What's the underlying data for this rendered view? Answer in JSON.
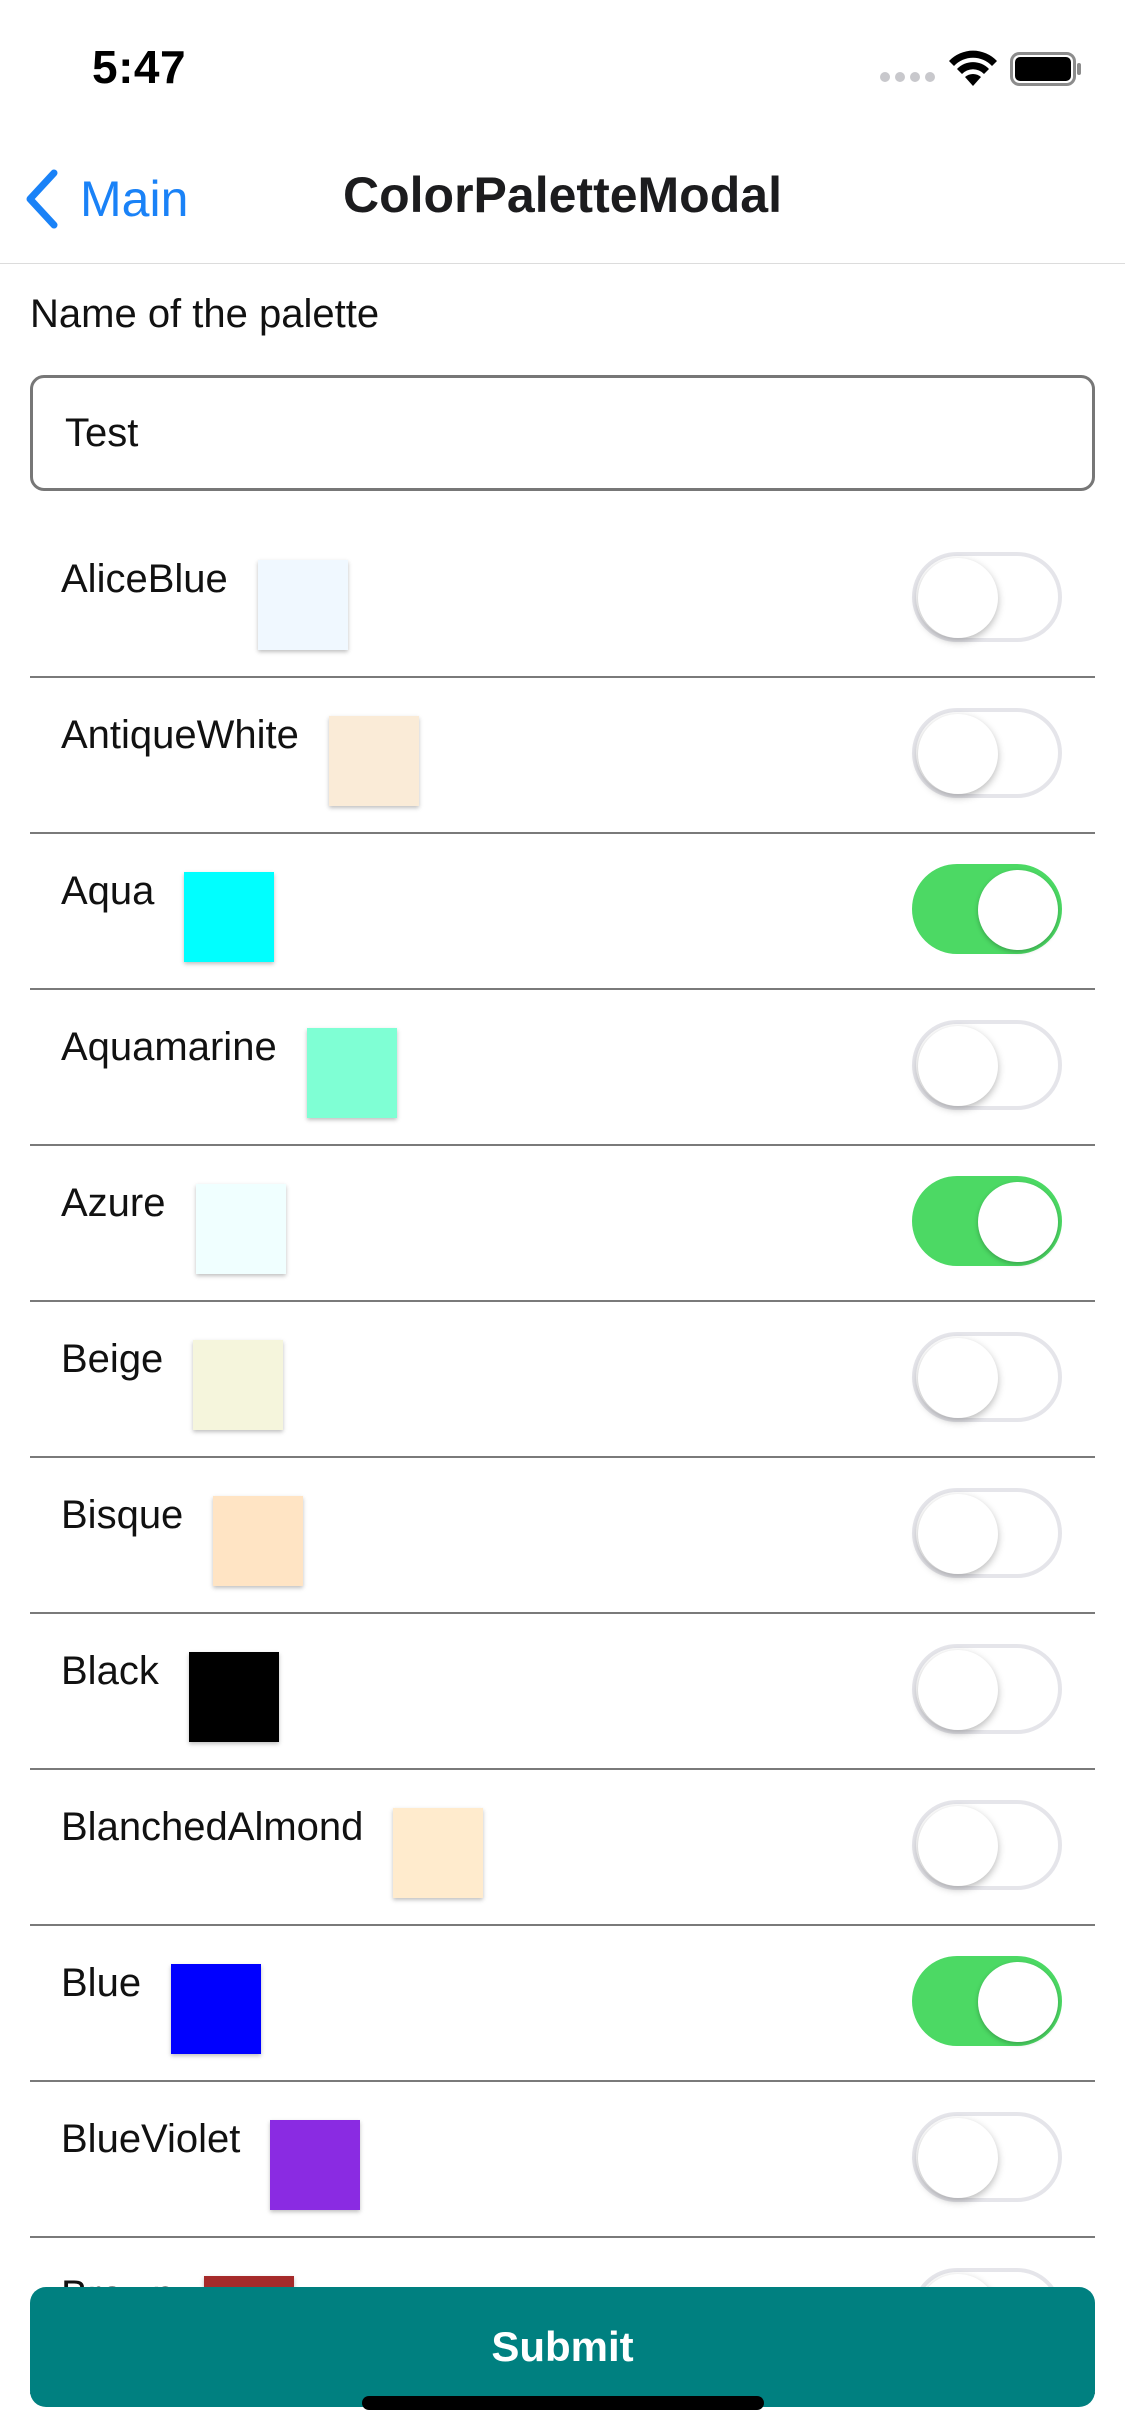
{
  "status_bar": {
    "time": "5:47"
  },
  "nav": {
    "back_label": "Main",
    "title": "ColorPaletteModal"
  },
  "form": {
    "name_label": "Name of the palette",
    "name_value": "Test"
  },
  "colors": [
    {
      "name": "AliceBlue",
      "hex": "#F0F8FF",
      "enabled": false
    },
    {
      "name": "AntiqueWhite",
      "hex": "#FAEBD7",
      "enabled": false
    },
    {
      "name": "Aqua",
      "hex": "#00FFFF",
      "enabled": true
    },
    {
      "name": "Aquamarine",
      "hex": "#7FFFD4",
      "enabled": false
    },
    {
      "name": "Azure",
      "hex": "#F0FFFF",
      "enabled": true
    },
    {
      "name": "Beige",
      "hex": "#F5F5DC",
      "enabled": false
    },
    {
      "name": "Bisque",
      "hex": "#FFE4C4",
      "enabled": false
    },
    {
      "name": "Black",
      "hex": "#000000",
      "enabled": false
    },
    {
      "name": "BlanchedAlmond",
      "hex": "#FFEBCD",
      "enabled": false
    },
    {
      "name": "Blue",
      "hex": "#0000FF",
      "enabled": true
    },
    {
      "name": "BlueViolet",
      "hex": "#8A2BE2",
      "enabled": false
    },
    {
      "name": "Brown",
      "hex": "#A52A2A",
      "enabled": false
    }
  ],
  "submit_label": "Submit",
  "theme": {
    "accent": "#1a82f7",
    "toggle_on": "#4cd964",
    "submit_bg": "#008080"
  }
}
